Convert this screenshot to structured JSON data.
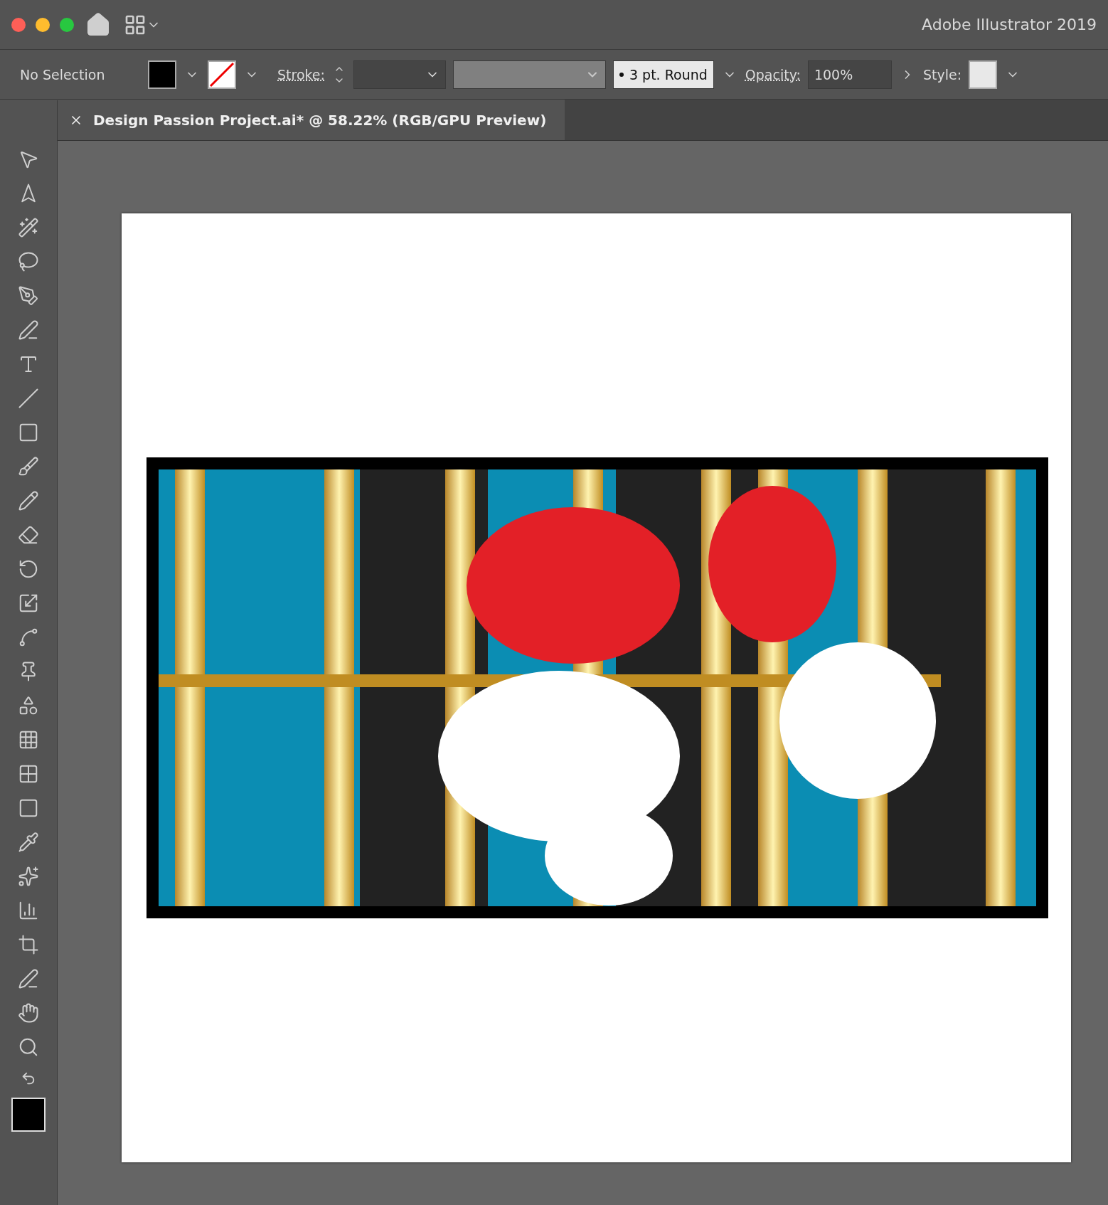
{
  "window": {
    "title": "Adobe Illustrator 2019"
  },
  "control_bar": {
    "selection": "No Selection",
    "stroke_label": "Stroke:",
    "brush": "3 pt. Round",
    "opacity_label": "Opacity:",
    "opacity": "100%",
    "style_label": "Style:"
  },
  "document_tab": {
    "title": "Design Passion Project.ai* @ 58.22% (RGB/GPU Preview)"
  }
}
